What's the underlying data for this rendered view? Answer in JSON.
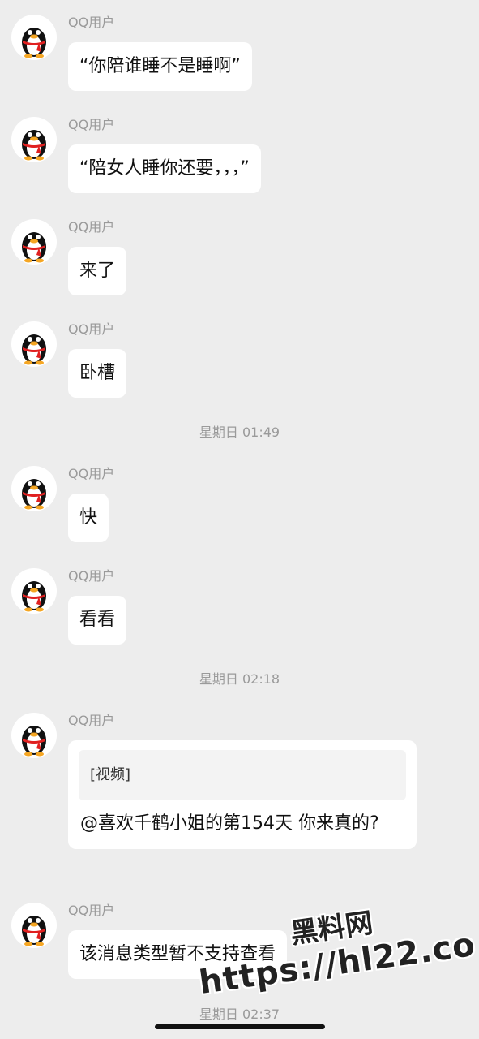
{
  "sender": "QQ用户",
  "messages": [
    {
      "text": "“你陪谁睡不是睡啊”"
    },
    {
      "text": "“陪女人睡你还要，，，”"
    },
    {
      "text": "来了"
    },
    {
      "text": "卧槽"
    },
    {
      "text": "快"
    },
    {
      "text": "看看"
    },
    {
      "quote": "[视频]",
      "text": "@喜欢千鹤小姐的第154天 你来真的?"
    },
    {
      "text": "该消息类型暂不支持查看"
    }
  ],
  "timestamps": [
    "星期日 01:49",
    "星期日 02:18",
    "星期日 02:37"
  ],
  "watermark": {
    "cn": "黑料网",
    "url": "https://hl22.co"
  },
  "colors": {
    "background": "#ededed",
    "bubble": "#ffffff",
    "meta_text": "#9a9a9a"
  }
}
